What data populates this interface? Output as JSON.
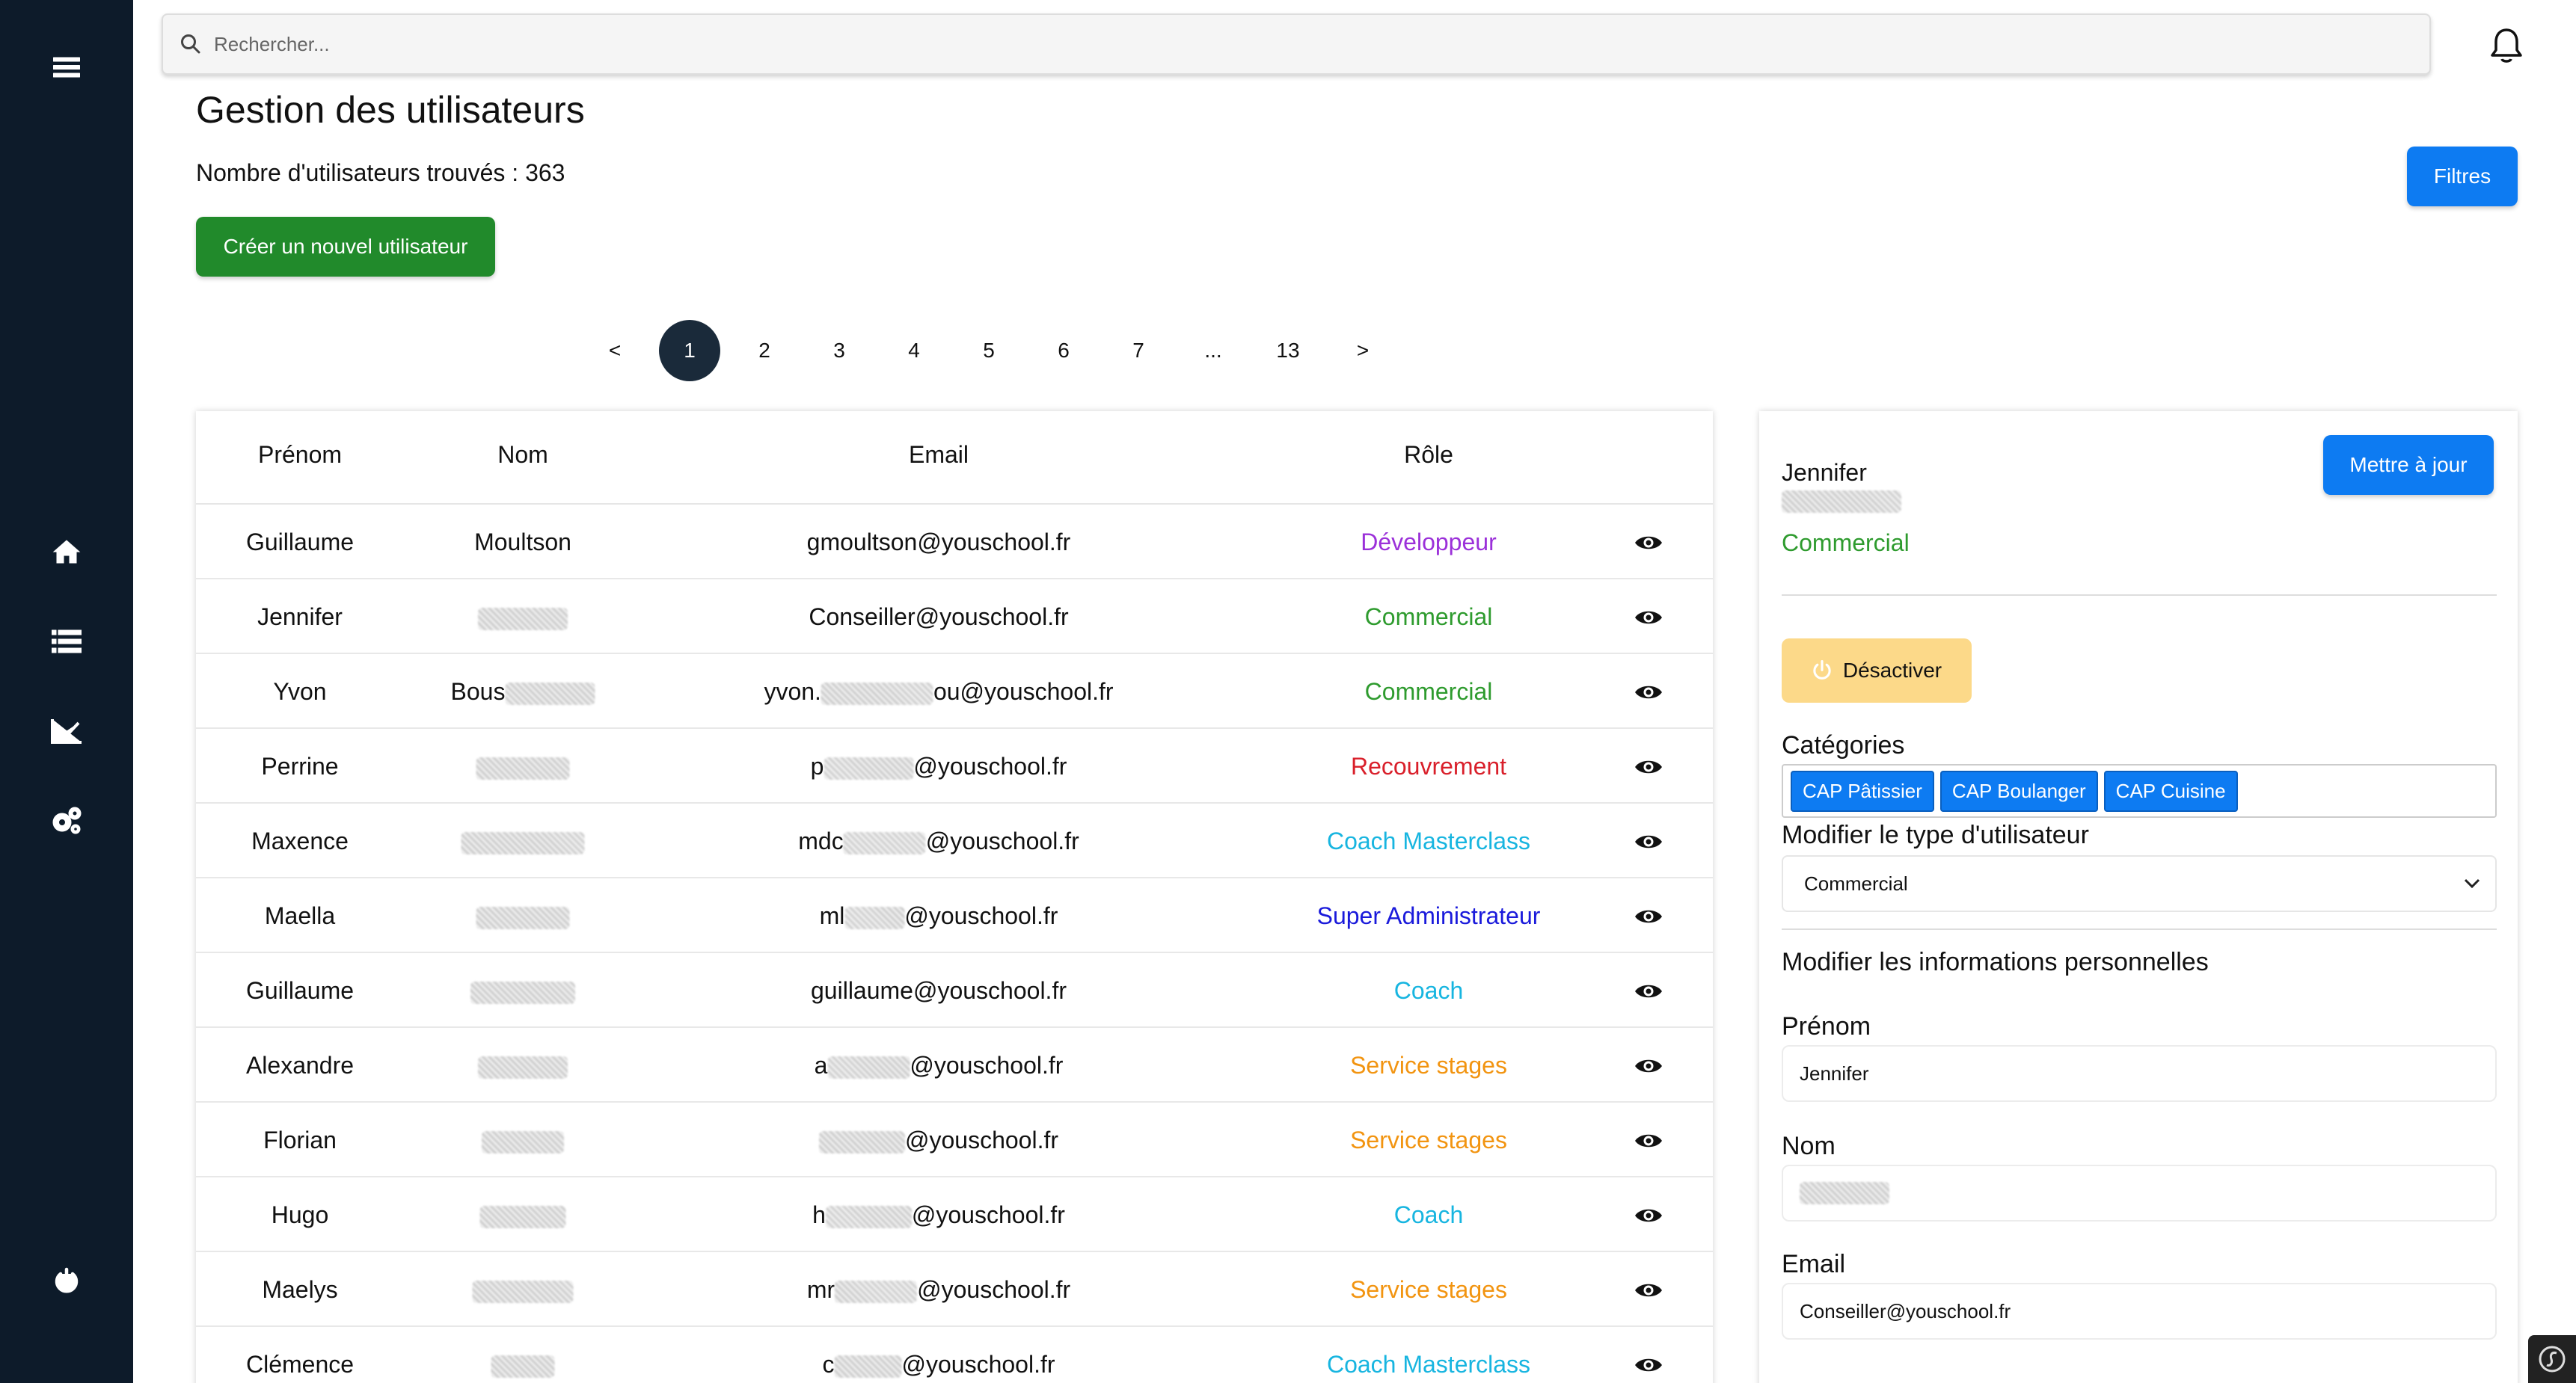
{
  "search": {
    "placeholder": "Rechercher..."
  },
  "page": {
    "title": "Gestion des utilisateurs",
    "count_text": "Nombre d'utilisateurs trouvés : 363",
    "create_button": "Créer un nouvel utilisateur",
    "filters_button": "Filtres"
  },
  "pagination": {
    "prev": "<",
    "next": ">",
    "pages": [
      "1",
      "2",
      "3",
      "4",
      "5",
      "6",
      "7",
      "...",
      "13"
    ],
    "current": "1"
  },
  "table": {
    "headers": {
      "prenom": "Prénom",
      "nom": "Nom",
      "email": "Email",
      "role": "Rôle"
    },
    "rows": [
      {
        "prenom": "Guillaume",
        "nom": "Moultson",
        "email": "gmoultson@youschool.fr",
        "role": "Développeur",
        "role_color": "#9b30d9"
      },
      {
        "prenom": "Jennifer",
        "nom": "",
        "email": "Conseiller@youschool.fr",
        "role": "Commercial",
        "role_color": "#2e9b2e"
      },
      {
        "prenom": "Yvon",
        "nom": "Bous",
        "email": "yvon.",
        "email_suffix": "ou@youschool.fr",
        "role": "Commercial",
        "role_color": "#2e9b2e"
      },
      {
        "prenom": "Perrine",
        "nom": "",
        "email": "p",
        "email_suffix": "@youschool.fr",
        "role": "Recouvrement",
        "role_color": "#d91f2a"
      },
      {
        "prenom": "Maxence",
        "nom": "",
        "email": "mdc",
        "email_suffix": "@youschool.fr",
        "role": "Coach Masterclass",
        "role_color": "#17b5e0"
      },
      {
        "prenom": "Maella",
        "nom": "",
        "email": "ml",
        "email_suffix": "@youschool.fr",
        "role": "Super Administrateur",
        "role_color": "#1a1adb"
      },
      {
        "prenom": "Guillaume",
        "nom": "",
        "email": "guillaume@youschool.fr",
        "role": "Coach",
        "role_color": "#17b5e0"
      },
      {
        "prenom": "Alexandre",
        "nom": "",
        "email": "a",
        "email_suffix": "@youschool.fr",
        "role": "Service stages",
        "role_color": "#f29410"
      },
      {
        "prenom": "Florian",
        "nom": "",
        "email": "",
        "email_suffix": "@youschool.fr",
        "role": "Service stages",
        "role_color": "#f29410"
      },
      {
        "prenom": "Hugo",
        "nom": "",
        "email": "h",
        "email_suffix": "@youschool.fr",
        "role": "Coach",
        "role_color": "#17b5e0"
      },
      {
        "prenom": "Maelys",
        "nom": "",
        "email": "mr",
        "email_suffix": "@youschool.fr",
        "role": "Service stages",
        "role_color": "#f29410"
      },
      {
        "prenom": "Clémence",
        "nom": "",
        "email": "c",
        "email_suffix": "@youschool.fr",
        "role": "Coach Masterclass",
        "role_color": "#17b5e0"
      }
    ]
  },
  "detail": {
    "first_name": "Jennifer",
    "role": "Commercial",
    "update_button": "Mettre à jour",
    "deactivate_button": "Désactiver",
    "categories_label": "Catégories",
    "categories": [
      "CAP Pâtissier",
      "CAP Boulanger",
      "CAP Cuisine"
    ],
    "type_label": "Modifier le type d'utilisateur",
    "type_value": "Commercial",
    "personal_info_label": "Modifier les informations personnelles",
    "prenom_label": "Prénom",
    "prenom_value": "Jennifer",
    "nom_label": "Nom",
    "email_label": "Email",
    "email_value": "Conseiller@youschool.fr"
  },
  "colors": {
    "sidebar": "#0d1b2a",
    "primary_blue": "#0d7bf2",
    "create_green": "#218a2b",
    "deactivate_yellow": "#fcd989",
    "pagination_active": "#1a2a3a"
  },
  "icons": {
    "sidebar": [
      "menu-icon",
      "home-icon",
      "list-icon",
      "chart-icon",
      "settings-icon",
      "power-icon"
    ],
    "topbar": [
      "search-icon",
      "bell-icon"
    ],
    "row_action": "eye-icon"
  }
}
